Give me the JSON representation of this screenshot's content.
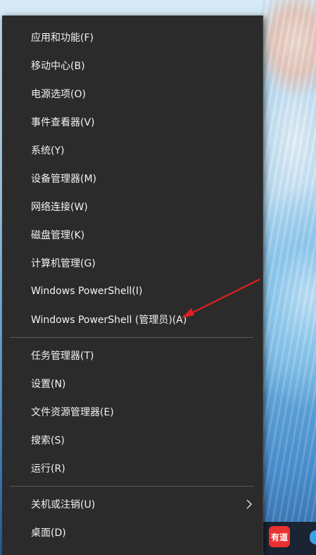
{
  "menu": {
    "items": [
      {
        "label": "应用和功能(F)"
      },
      {
        "label": "移动中心(B)"
      },
      {
        "label": "电源选项(O)"
      },
      {
        "label": "事件查看器(V)"
      },
      {
        "label": "系统(Y)"
      },
      {
        "label": "设备管理器(M)"
      },
      {
        "label": "网络连接(W)"
      },
      {
        "label": "磁盘管理(K)"
      },
      {
        "label": "计算机管理(G)"
      },
      {
        "label": "Windows PowerShell(I)"
      },
      {
        "label": "Windows PowerShell (管理员)(A)"
      },
      {
        "label": "任务管理器(T)"
      },
      {
        "label": "设置(N)"
      },
      {
        "label": "文件资源管理器(E)"
      },
      {
        "label": "搜索(S)"
      },
      {
        "label": "运行(R)"
      },
      {
        "label": "关机或注销(U)"
      },
      {
        "label": "桌面(D)"
      }
    ]
  },
  "taskbar": {
    "youdao_label": "有道"
  },
  "annotation": {
    "arrow_color": "#e02020"
  }
}
